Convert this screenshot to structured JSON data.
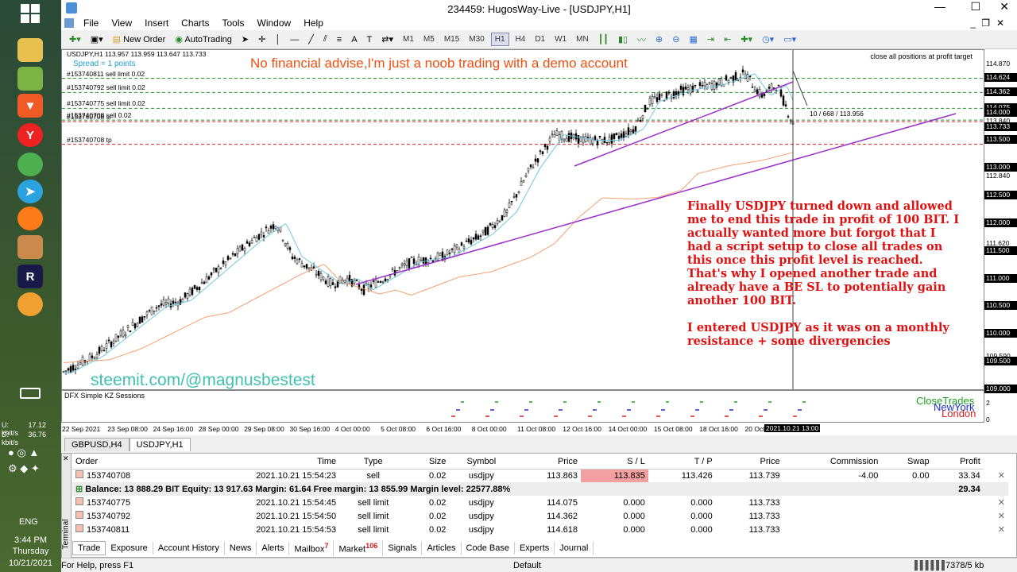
{
  "taskbar": {
    "kbit1": "17.12 kbit/s",
    "kbit2": "36.76 kbit/s",
    "lang": "ENG",
    "time": "3:44 PM",
    "day": "Thursday",
    "date": "10/21/2021",
    "u_label": "U:",
    "d_label": "D:"
  },
  "window": {
    "title": "234459: HugosWay-Live - [USDJPY,H1]"
  },
  "menu": [
    "File",
    "View",
    "Insert",
    "Charts",
    "Tools",
    "Window",
    "Help"
  ],
  "toolbar": {
    "new_order": "New Order",
    "autotrading": "AutoTrading",
    "timeframes": [
      "M1",
      "M5",
      "M15",
      "M30",
      "H1",
      "H4",
      "D1",
      "W1",
      "MN"
    ]
  },
  "chart": {
    "symbol_info": "USDJPY,H1  113.957 113.959 113.647 113.733",
    "spread_text": "Spread = 1 points",
    "watermark": "No financial advise,I'm just a noob trading with a demo account",
    "top_right": "close all positions at profit target",
    "crosshair_readout": "10 / 668 / 113.956",
    "steemit": "steemit.com/@magnusbestest",
    "order_lines": [
      {
        "label": "#153740811 sell limit 0.02",
        "price": 114.618
      },
      {
        "label": "#153740792 sell limit 0.02",
        "price": 114.362
      },
      {
        "label": "#153740775 sell limit 0.02",
        "price": 114.075
      },
      {
        "label": "#153740708 sl",
        "price": 113.835
      },
      {
        "label": "#153740708 sell 0.02",
        "price": 113.863
      },
      {
        "label": "#153740708 tp",
        "price": 113.426
      }
    ],
    "note": "Finally USDJPY turned down and allowed me to end this trade in profit of 100 BIT. I actually wanted more but forgot that I had a script setup to close all trades on this once this profit level is reached. That's why I opened another trade and already have a BE SL to potentially gain another 100 BIT.\n\nI entered USDJPY as it was on a monthly resistance + some divergencies",
    "indicator_name": "DFX Simple KZ Sessions",
    "sessions": [
      "CloseTrades",
      "NewYork",
      "London"
    ],
    "ind_scale": [
      "0",
      "2"
    ],
    "y_labels": [
      "114.870",
      "114.350",
      "113.840",
      "113.500",
      "113.000",
      "112.840",
      "112.500",
      "112.000",
      "111.620",
      "111.500",
      "111.000",
      "110.500",
      "110.000",
      "109.590",
      "109.500",
      "109.000"
    ],
    "y_tags": [
      "114.624",
      "114.362",
      "114.075",
      "114.000",
      "113.733",
      "113.500",
      "113.000",
      "112.500",
      "112.000",
      "111.500",
      "111.000",
      "110.500",
      "110.000",
      "109.500",
      "109.000"
    ],
    "x_labels": [
      "22 Sep 2021",
      "23 Sep 08:00",
      "24 Sep 16:00",
      "28 Sep 00:00",
      "29 Sep 08:00",
      "30 Sep 16:00",
      "4 Oct 00:00",
      "5 Oct 08:00",
      "6 Oct 16:00",
      "8 Oct 00:00",
      "11 Oct 08:00",
      "12 Oct 16:00",
      "14 Oct 00:00",
      "15 Oct 08:00",
      "18 Oct 16:00",
      "20 Oct 00:00"
    ],
    "x_cursor": "2021.10.21 13:00"
  },
  "chart_tabs": [
    "GBPUSD,H4",
    "USDJPY,H1"
  ],
  "terminal": {
    "side_label": "Terminal",
    "headers": [
      "Order",
      "Time",
      "Type",
      "Size",
      "Symbol",
      "Price",
      "S / L",
      "T / P",
      "Price",
      "Commission",
      "Swap",
      "Profit"
    ],
    "rows": [
      [
        "153740708",
        "2021.10.21 15:54:23",
        "sell",
        "0.02",
        "usdjpy",
        "113.863",
        "113.835",
        "113.426",
        "113.739",
        "-4.00",
        "0.00",
        "33.34"
      ],
      [
        "153740775",
        "2021.10.21 15:54:45",
        "sell limit",
        "0.02",
        "usdjpy",
        "114.075",
        "0.000",
        "0.000",
        "113.733",
        "",
        "",
        ""
      ],
      [
        "153740792",
        "2021.10.21 15:54:50",
        "sell limit",
        "0.02",
        "usdjpy",
        "114.362",
        "0.000",
        "0.000",
        "113.733",
        "",
        "",
        ""
      ],
      [
        "153740811",
        "2021.10.21 15:54:53",
        "sell limit",
        "0.02",
        "usdjpy",
        "114.618",
        "0.000",
        "0.000",
        "113.733",
        "",
        "",
        ""
      ]
    ],
    "balance": "Balance: 13 888.29 BIT  Equity: 13 917.63  Margin: 61.64  Free margin: 13 855.99  Margin level: 22577.88%",
    "balance_profit": "29.34",
    "tabs": [
      "Trade",
      "Exposure",
      "Account History",
      "News",
      "Alerts",
      "Mailbox",
      "Market",
      "Signals",
      "Articles",
      "Code Base",
      "Experts",
      "Journal"
    ],
    "mailbox_count": "7",
    "market_count": "106"
  },
  "status": {
    "help": "For Help, press F1",
    "profile": "Default",
    "traffic": "7378/5 kb"
  }
}
